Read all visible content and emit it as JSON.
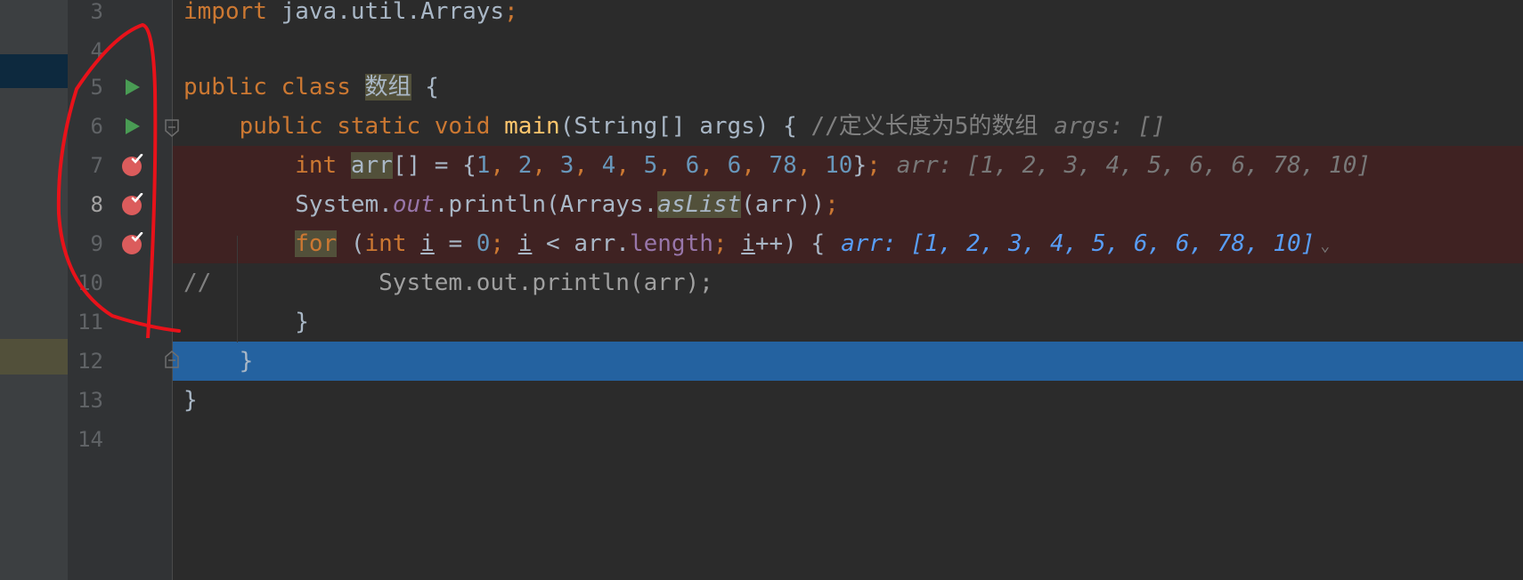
{
  "line_numbers": [
    "3",
    "4",
    "5",
    "6",
    "7",
    "8",
    "9",
    "10",
    "11",
    "12",
    "13",
    "14"
  ],
  "code": {
    "l3": {
      "kw": "import",
      "text": " java.util.Arrays",
      "semi": ";"
    },
    "l5": {
      "kw1": "public",
      "kw2": "class",
      "name": "数组",
      "brace": "{"
    },
    "l6": {
      "kw1": "public",
      "kw2": "static",
      "kw3": "void",
      "fn": "main",
      "params": "(String[] args) {",
      "comment": "//定义长度为5的数组",
      "hint": "args: []"
    },
    "l7": {
      "kw": "int",
      "var": "arr",
      "rest": "[] = {",
      "nums": [
        "1",
        "2",
        "3",
        "4",
        "5",
        "6",
        "6",
        "78",
        "10"
      ],
      "close": "}",
      "semi": ";",
      "hint": "arr: [1, 2, 3, 4, 5, 6, 6, 78, 10]"
    },
    "l8": {
      "obj": "System.",
      "field": "out",
      "call": ".println(Arrays.",
      "method": "asList",
      "args": "(arr))",
      "semi": ";"
    },
    "l9": {
      "kw": "for",
      "open": " (",
      "kw_int": "int",
      "i1": "i",
      "eq": " = ",
      "zero": "0",
      "semi1": ";",
      "i2": "i",
      "lt": " < arr.",
      "len": "length",
      "semi2": ";",
      "i3": "i",
      "inc": "++) {",
      "hint": "arr: [1, 2, 3, 4, 5, 6, 6, 78, 10]",
      "chevron": "⌄"
    },
    "l10": {
      "comment_mark": "//",
      "comment": "            System.out.println(arr);"
    },
    "l11": {
      "brace": "}"
    },
    "l12": {
      "brace": "}"
    },
    "l13": {
      "brace": "}"
    }
  },
  "colors": {
    "keyword": "#cc7832",
    "number": "#6897bb",
    "function": "#ffc66d",
    "breakpoint_line": "#3f2222",
    "execution_line": "#2462a0",
    "annotation": "#e8121a"
  },
  "gutter_icons": {
    "run_lines": [
      "5",
      "6"
    ],
    "breakpoint_lines": [
      "7",
      "8",
      "9"
    ],
    "fold_lines": [
      "6",
      "12"
    ]
  }
}
